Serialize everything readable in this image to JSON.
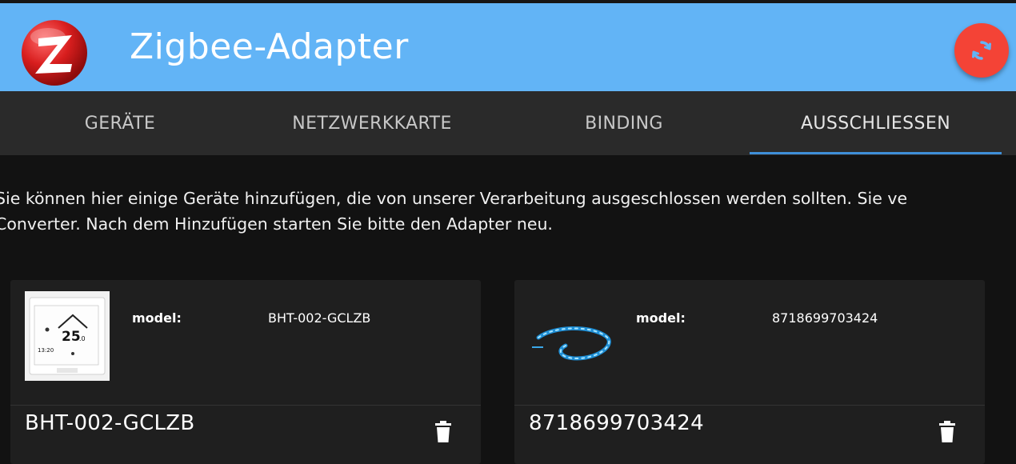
{
  "app": {
    "title": "Zigbee-Adapter",
    "logo_icon": "zigbee-logo-icon",
    "refresh_icon": "refresh-icon",
    "colors": {
      "appbar": "#62b4f6",
      "fab": "#f44336",
      "tab_indicator": "#3f8fd8",
      "background": "#121212",
      "card": "#1f1f1f"
    }
  },
  "tabs": [
    {
      "label": "GERÄTE"
    },
    {
      "label": "NETZWERKKARTE"
    },
    {
      "label": "BINDING"
    },
    {
      "label": "AUSSCHLIESSEN",
      "active": true
    }
  ],
  "description": {
    "line1": "Sie können hier einige Geräte hinzufügen, die von unserer Verarbeitung ausgeschlossen werden sollten. Sie ve",
    "line2": "Converter. Nach dem Hinzufügen starten Sie bitte den Adapter neu."
  },
  "devices": [
    {
      "key": "model:",
      "value": "BHT-002-GCLZB",
      "name": "BHT-002-GCLZB",
      "image": "thermostat-image",
      "delete_icon": "trash-icon"
    },
    {
      "key": "model:",
      "value": "8718699703424",
      "name": "8718699703424",
      "image": "lightstrip-image",
      "delete_icon": "trash-icon"
    }
  ]
}
